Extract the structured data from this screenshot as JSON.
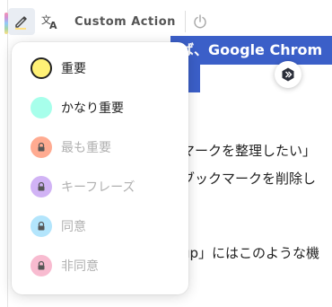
{
  "toolbar": {
    "pen_icon": "highlighter-pen-icon",
    "translate_icon": "translate-icon",
    "custom_action_label": "Custom Action",
    "power_icon": "power-icon",
    "accent_colors": [
      "#f48fb1",
      "#ce93d8",
      "#90caf9",
      "#a5d6a7",
      "#ffe082"
    ]
  },
  "menu": {
    "items": [
      {
        "label": "重要",
        "color": "#fff176",
        "locked": false
      },
      {
        "label": "かなり重要",
        "color": "#a7ffeb",
        "locked": false
      },
      {
        "label": "最も重要",
        "color": "#ffab91",
        "locked": true
      },
      {
        "label": "キーフレーズ",
        "color": "#d1b3f5",
        "locked": true
      },
      {
        "label": "同意",
        "color": "#b3e5fc",
        "locked": true
      },
      {
        "label": "非同意",
        "color": "#f8bbd0",
        "locked": true
      }
    ]
  },
  "page": {
    "highlight_text": "ば、Google Chrom",
    "highlight_color": "#3b5fc8",
    "lines": [
      "マークを整理したい」",
      "ブックマークを削除し",
      "up」にはこのような機"
    ]
  }
}
